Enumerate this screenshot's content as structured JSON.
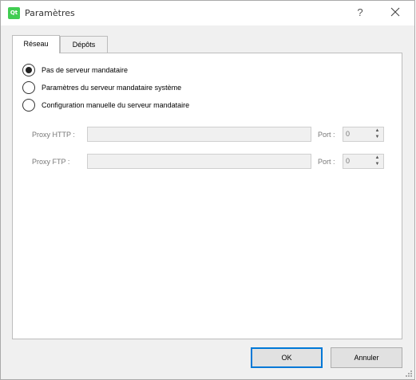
{
  "window": {
    "app_icon_text": "Qt",
    "title": "Paramètres",
    "help_glyph": "?",
    "accent_color": "#0078d7"
  },
  "tabs": [
    {
      "label": "Réseau",
      "active": true
    },
    {
      "label": "Dépôts",
      "active": false
    }
  ],
  "network": {
    "proxy_options": [
      {
        "label": "Pas de serveur mandataire",
        "checked": true
      },
      {
        "label": "Paramètres du serveur mandataire système",
        "checked": false
      },
      {
        "label": "Configuration manuelle du serveur mandataire",
        "checked": false
      }
    ],
    "http": {
      "label": "Proxy HTTP :",
      "value": "",
      "port_label": "Port :",
      "port": "0"
    },
    "ftp": {
      "label": "Proxy FTP :",
      "value": "",
      "port_label": "Port :",
      "port": "0"
    }
  },
  "buttons": {
    "ok": "OK",
    "cancel": "Annuler"
  },
  "icons": {
    "app": "qt-logo-icon",
    "help": "help-icon",
    "close": "close-icon",
    "spin_up": "arrow-up-icon",
    "spin_down": "arrow-down-icon",
    "grip": "resize-grip-icon"
  }
}
